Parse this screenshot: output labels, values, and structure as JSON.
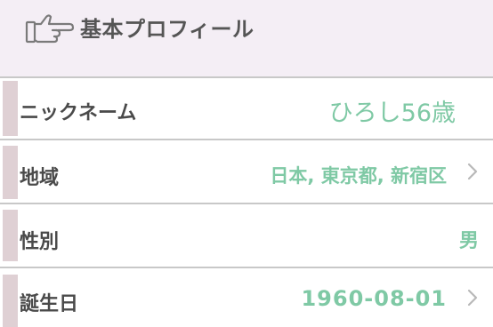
{
  "header": {
    "title": "基本プロフィール",
    "icon": "pointing-hand-icon"
  },
  "rows": [
    {
      "label": "ニックネーム",
      "value": "ひろし56歳",
      "has_chevron": false
    },
    {
      "label": "地域",
      "value": "日本, 東京都, 新宿区",
      "has_chevron": true
    },
    {
      "label": "性別",
      "value": "男",
      "has_chevron": false
    },
    {
      "label": "誕生日",
      "value": "1960-08-01",
      "has_chevron": true
    }
  ],
  "colors": {
    "header_bg": "#f4eef5",
    "accent_bar": "#dfd0d4",
    "value_text": "#7fc9a5",
    "label_text": "#4a4a4a",
    "divider": "#c8c8c8",
    "chevron": "#b8b8b8"
  }
}
